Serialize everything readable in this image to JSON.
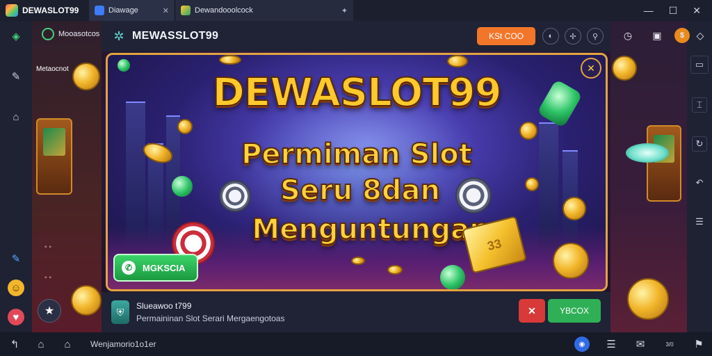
{
  "titlebar": {
    "app_name": "DEWASLOT99",
    "tabs": [
      {
        "label": "Diawage",
        "close": "✕"
      },
      {
        "label": "Dewandooolcock",
        "close": "✦"
      }
    ],
    "controls": {
      "minimize": "—",
      "maximize": "☐",
      "close": "✕"
    }
  },
  "left_panel": {
    "app_label": "Mooasotcos",
    "sub_label": "Metaocnot",
    "dots1": "◦ ◦",
    "dots2": "◦ ◦"
  },
  "header": {
    "title": "MEWASSLOT99",
    "action_button": "KSt COO",
    "icons": [
      "compass-icon",
      "share-icon",
      "search-icon"
    ]
  },
  "banner": {
    "title_line1": "DEWASLOT99",
    "title_line2": "Permiman Slot",
    "title_line3": "Seru 8dan",
    "title_line4": "Menguntungan",
    "cta_label": "MGKSCIA",
    "card_text": "33"
  },
  "info": {
    "line1": "Slueawoo t799",
    "line2": "Permaininan Slot Serari Mergaengotoas",
    "red_button": "✕",
    "green_button": "YBCOX"
  },
  "taskbar": {
    "text": "Wenjamorio1o1er",
    "counter": "3/0"
  },
  "colors": {
    "accent_orange": "#f2762a",
    "accent_green": "#2fb057",
    "accent_red": "#d83a3a",
    "gold": "#ffd23a",
    "banner_border": "#e3a440"
  }
}
